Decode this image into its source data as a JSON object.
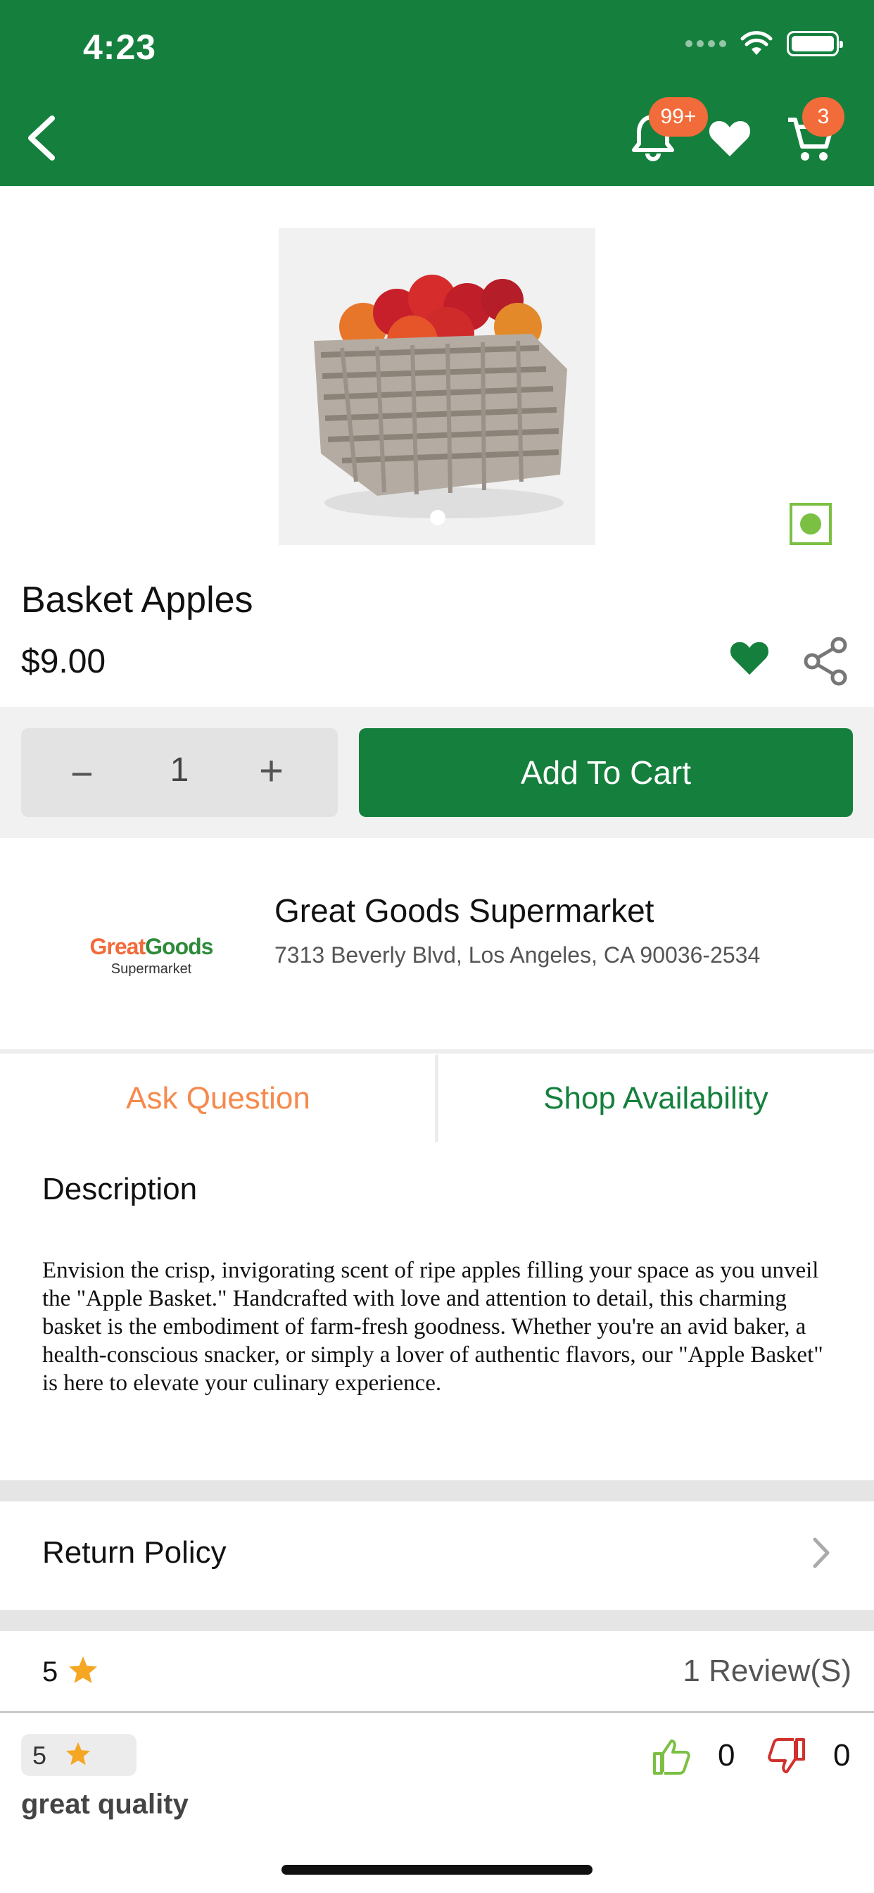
{
  "status_bar": {
    "time": "4:23"
  },
  "header": {
    "notification_badge": "99+",
    "cart_badge": "3",
    "accent_color": "#15803d",
    "badge_color": "#f26b3a"
  },
  "product": {
    "title": "Basket Apples",
    "price": "$9.00",
    "image_icon": "apple-basket-image"
  },
  "cart": {
    "minus_label": "−",
    "quantity": "1",
    "plus_label": "+",
    "add_label": "Add To Cart"
  },
  "store": {
    "logo_main_1": "Great",
    "logo_main_2": "Goods",
    "logo_sub": "Supermarket",
    "name": "Great Goods Supermarket",
    "address": "7313 Beverly Blvd, Los Angeles, CA 90036-2534"
  },
  "tabs": [
    {
      "label": "Ask Question"
    },
    {
      "label": "Shop Availability"
    }
  ],
  "description": {
    "title": "Description",
    "text": "Envision the crisp, invigorating scent of ripe apples filling your space as you unveil the \"Apple Basket.\" Handcrafted with love and attention to detail, this charming basket is the embodiment of farm-fresh goodness. Whether you're an avid baker, a health-conscious snacker, or simply a lover of authentic flavors, our \"Apple Basket\" is here to elevate your culinary experience."
  },
  "return_policy": {
    "label": "Return Policy"
  },
  "rating_summary": {
    "value": "5",
    "reviews": "1 Review(S)"
  },
  "review": {
    "rating": "5",
    "likes": "0",
    "dislikes": "0",
    "text": "great quality"
  }
}
